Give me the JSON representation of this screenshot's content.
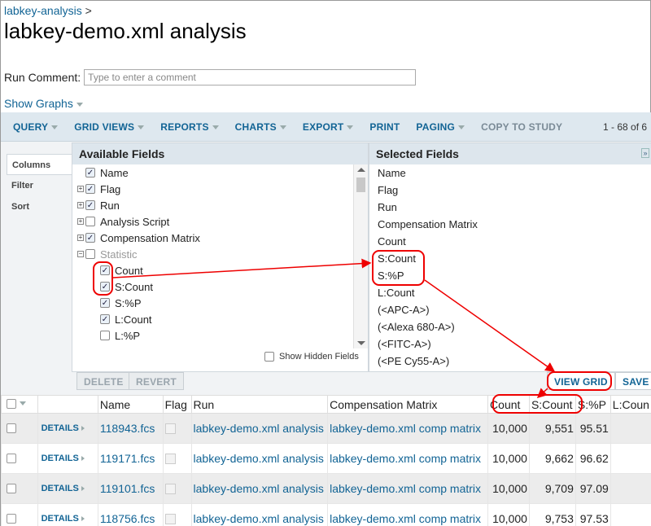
{
  "breadcrumb": {
    "link": "labkey-analysis",
    "separator": ">"
  },
  "title": "labkey-demo.xml analysis",
  "run_comment": {
    "label": "Run Comment:",
    "placeholder": "Type to enter a comment",
    "value": ""
  },
  "show_graphs": "Show Graphs",
  "toolbar": {
    "items": [
      "QUERY",
      "GRID VIEWS",
      "REPORTS",
      "CHARTS",
      "EXPORT",
      "PRINT",
      "PAGING",
      "COPY TO STUDY"
    ],
    "count": "1 - 68 of 6"
  },
  "side_tabs": [
    "Columns",
    "Filter",
    "Sort"
  ],
  "available_fields": {
    "header": "Available Fields",
    "rows": [
      {
        "label": "Name",
        "checked": true,
        "expandable": false
      },
      {
        "label": "Flag",
        "checked": true,
        "expandable": true
      },
      {
        "label": "Run",
        "checked": true,
        "expandable": true
      },
      {
        "label": "Analysis Script",
        "checked": false,
        "expandable": true
      },
      {
        "label": "Compensation Matrix",
        "checked": true,
        "expandable": true
      },
      {
        "label": "Statistic",
        "checked": false,
        "expandable": true,
        "expanded": true
      },
      {
        "label": "Count",
        "checked": true
      },
      {
        "label": "S:Count",
        "checked": true
      },
      {
        "label": "S:%P",
        "checked": true
      },
      {
        "label": "L:Count",
        "checked": true
      },
      {
        "label": "L:%P",
        "checked": false
      }
    ],
    "show_hidden": "Show Hidden Fields"
  },
  "selected_fields": {
    "header": "Selected Fields",
    "rows": [
      "Name",
      "Flag",
      "Run",
      "Compensation Matrix",
      "Count",
      "S:Count",
      "S:%P",
      "L:Count",
      "(<APC-A>)",
      "(<Alexa 680-A>)",
      "(<FITC-A>)",
      "(<PE Cy55-A>)"
    ]
  },
  "buttons": {
    "delete": "DELETE",
    "revert": "REVERT",
    "view_grid": "VIEW GRID",
    "save": "SAVE"
  },
  "grid": {
    "columns": [
      "",
      "",
      "Name",
      "Flag",
      "Run",
      "Compensation Matrix",
      "Count",
      "S:Count",
      "S:%P",
      "L:Coun"
    ],
    "details_label": "DETAILS",
    "rows": [
      {
        "name": "118943.fcs",
        "run": "labkey-demo.xml analysis",
        "comp": "labkey-demo.xml comp matrix",
        "count": "10,000",
        "s_count": "9,551",
        "s_p": "95.51"
      },
      {
        "name": "119171.fcs",
        "run": "labkey-demo.xml analysis",
        "comp": "labkey-demo.xml comp matrix",
        "count": "10,000",
        "s_count": "9,662",
        "s_p": "96.62"
      },
      {
        "name": "119101.fcs",
        "run": "labkey-demo.xml analysis",
        "comp": "labkey-demo.xml comp matrix",
        "count": "10,000",
        "s_count": "9,709",
        "s_p": "97.09"
      },
      {
        "name": "118756.fcs",
        "run": "labkey-demo.xml analysis",
        "comp": "labkey-demo.xml comp matrix",
        "count": "10,000",
        "s_count": "9,753",
        "s_p": "97.53"
      }
    ]
  },
  "colors": {
    "link": "#126495",
    "annotation": "#e00000",
    "toolbar_bg": "#dee8ef"
  }
}
